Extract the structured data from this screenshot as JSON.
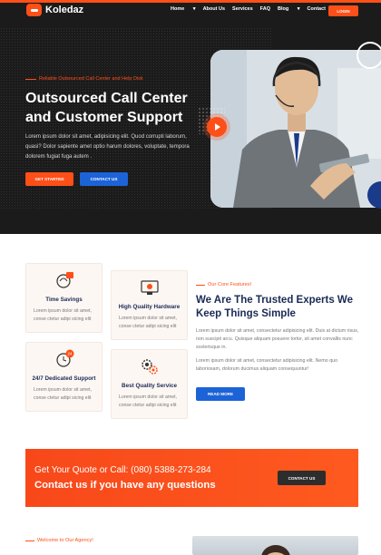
{
  "brand": {
    "name": "Koledaz",
    "accent": "#fe4f18",
    "blue": "#1c63d8",
    "navy": "#1a2a55"
  },
  "nav": {
    "items": [
      "Home",
      "About Us",
      "Services",
      "FAQ",
      "Blog",
      "Contact"
    ],
    "has_dropdown": [
      true,
      false,
      false,
      false,
      true,
      false
    ],
    "login": "LOGIN"
  },
  "hero": {
    "eyebrow": "Reliable Outsourced Call Center and Help Disk",
    "title_line1": "Outsourced Call Center",
    "title_line2": "and Customer Support",
    "lead": "Lorem ipsum dolor sit amet, adipisicing elit. Quod corrupti laborum, quasi? Dolor sapiente amet optio harum dolores, voluptate, tempora dolorem fugiat fuga autem .",
    "btn_start": "GET STARTED",
    "btn_contact": "CONTACT US"
  },
  "features": {
    "cards": [
      {
        "icon": "support-phone-icon",
        "title": "Time Savings",
        "desc": "Lorem ipsum dolor sit amet, conse ctetur adipi sicing elit"
      },
      {
        "icon": "hardware-monitor-icon",
        "title": "High Quality Hardware",
        "desc": "Lorem ipsum dolor sit amet, conse ctetur adipi sicing elit"
      },
      {
        "icon": "clock-24-icon",
        "title": "24/7 Dedicated Support",
        "desc": "Lorem ipsum dolor sit amet, conse ctetur adipi sicing elit"
      },
      {
        "icon": "gears-icon",
        "title": "Best Quality Service",
        "desc": "Lorem ipsum dolor sit amet, conse ctetur adipi sicing elit"
      }
    ],
    "eyebrow": "Our Core Features!",
    "title_line1": "We Are The Trusted Experts We",
    "title_line2": "Keep Things Simple",
    "p1": "Lorem ipsum dolor sit amet, consectetur adipisicing elit. Duis at dictum risus, non suscipit arcu. Quisque aliquam posuere tortor, sit amet convallis nunc scelerisque in.",
    "p2": "Lorem ipsum dolor sit amet, consectetur adipisicing elit. Nemo quo laboriosam, dolorum ducimus aliquam consequuntur!",
    "btn_more": "READ MORE"
  },
  "cta": {
    "line1": "Get Your Quote or Call: (080) 5388-273-284",
    "line2": "Contact us if you have any questions",
    "button": "CONTACT US"
  },
  "agency": {
    "eyebrow": "Welcome to Our Agency!"
  }
}
